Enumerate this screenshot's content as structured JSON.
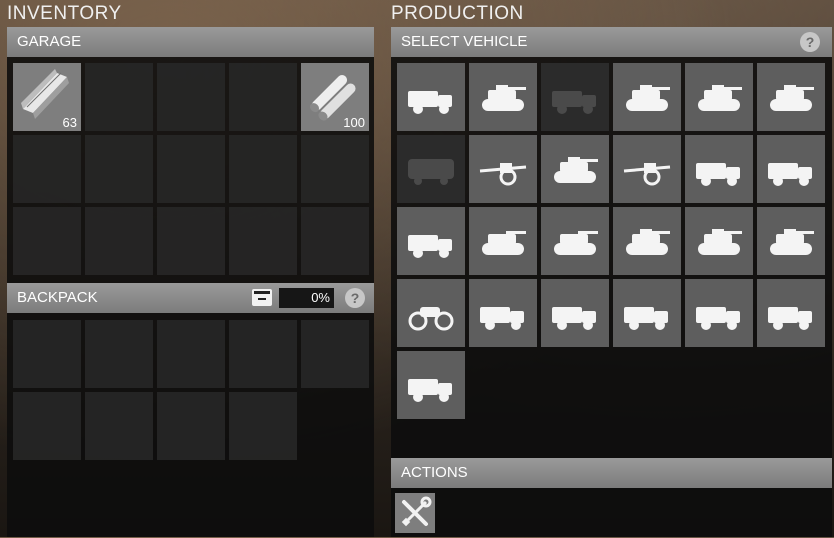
{
  "inventory": {
    "title": "INVENTORY",
    "garage": {
      "label": "GARAGE",
      "slots": [
        {
          "item": "steel-beam-icon",
          "count": "63"
        },
        {
          "item": null,
          "count": ""
        },
        {
          "item": null,
          "count": ""
        },
        {
          "item": null,
          "count": ""
        },
        {
          "item": "pipes-icon",
          "count": "100"
        }
      ]
    },
    "backpack": {
      "label": "BACKPACK",
      "encumbrance": "0%",
      "help": "?"
    }
  },
  "production": {
    "title": "PRODUCTION",
    "select_vehicle": {
      "label": "SELECT VEHICLE",
      "help": "?"
    },
    "vehicles": [
      {
        "icon": "ambulance-icon",
        "available": true
      },
      {
        "icon": "light-tank-icon",
        "available": true
      },
      {
        "icon": "armored-car-icon",
        "available": false
      },
      {
        "icon": "tank-icon",
        "available": true
      },
      {
        "icon": "tank-icon",
        "available": true
      },
      {
        "icon": "tank-icon",
        "available": true
      },
      {
        "icon": "bus-icon",
        "available": false
      },
      {
        "icon": "field-gun-icon",
        "available": true
      },
      {
        "icon": "anti-tank-gun-icon",
        "available": true
      },
      {
        "icon": "towed-gun-icon",
        "available": true
      },
      {
        "icon": "halftrack-truck-icon",
        "available": true
      },
      {
        "icon": "halftrack-icon",
        "available": true
      },
      {
        "icon": "armored-car-icon",
        "available": true
      },
      {
        "icon": "tracked-carrier-icon",
        "available": true
      },
      {
        "icon": "amphibious-vehicle-icon",
        "available": true
      },
      {
        "icon": "tank-icon",
        "available": true
      },
      {
        "icon": "tank-icon",
        "available": true
      },
      {
        "icon": "heavy-tank-icon",
        "available": true
      },
      {
        "icon": "motorcycle-icon",
        "available": true
      },
      {
        "icon": "truck-icon",
        "available": true
      },
      {
        "icon": "armored-truck-icon",
        "available": true
      },
      {
        "icon": "armored-truck-icon",
        "available": true
      },
      {
        "icon": "cargo-truck-icon",
        "available": true
      },
      {
        "icon": "tracked-truck-icon",
        "available": true
      },
      {
        "icon": "construction-truck-icon",
        "available": true
      }
    ],
    "actions": {
      "label": "ACTIONS",
      "buttons": [
        {
          "icon": "wrench-screwdriver-icon"
        }
      ]
    }
  }
}
